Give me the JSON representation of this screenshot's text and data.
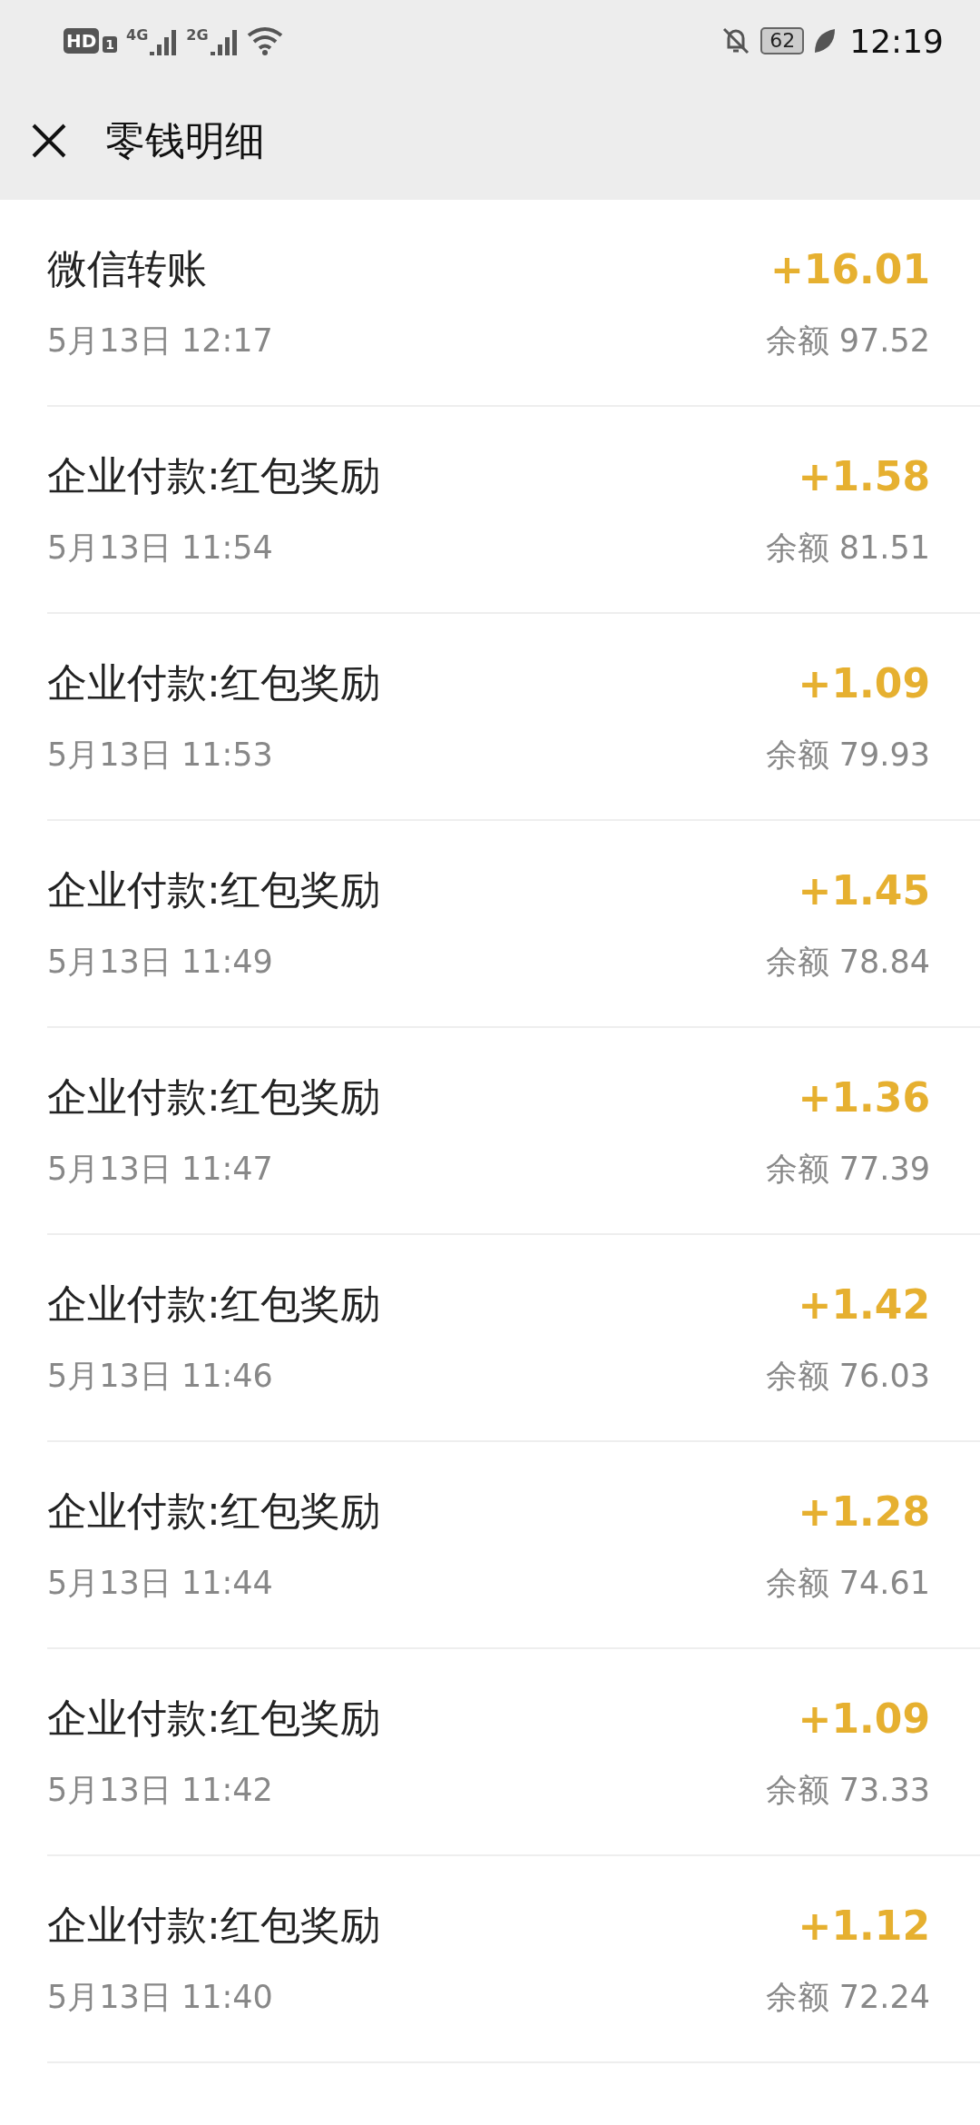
{
  "status_bar": {
    "hd_label": "HD",
    "sim_label": "1",
    "time": "12:19",
    "battery": "62",
    "signal_1_label": "4G",
    "signal_2_label": "2G"
  },
  "header": {
    "title": "零钱明细"
  },
  "transactions": [
    {
      "title": "微信转账",
      "time": "5月13日 12:17",
      "amount": "+16.01",
      "balance": "余额 97.52"
    },
    {
      "title": "企业付款:红包奖励",
      "time": "5月13日 11:54",
      "amount": "+1.58",
      "balance": "余额 81.51"
    },
    {
      "title": "企业付款:红包奖励",
      "time": "5月13日 11:53",
      "amount": "+1.09",
      "balance": "余额 79.93"
    },
    {
      "title": "企业付款:红包奖励",
      "time": "5月13日 11:49",
      "amount": "+1.45",
      "balance": "余额 78.84"
    },
    {
      "title": "企业付款:红包奖励",
      "time": "5月13日 11:47",
      "amount": "+1.36",
      "balance": "余额 77.39"
    },
    {
      "title": "企业付款:红包奖励",
      "time": "5月13日 11:46",
      "amount": "+1.42",
      "balance": "余额 76.03"
    },
    {
      "title": "企业付款:红包奖励",
      "time": "5月13日 11:44",
      "amount": "+1.28",
      "balance": "余额 74.61"
    },
    {
      "title": "企业付款:红包奖励",
      "time": "5月13日 11:42",
      "amount": "+1.09",
      "balance": "余额 73.33"
    },
    {
      "title": "企业付款:红包奖励",
      "time": "5月13日 11:40",
      "amount": "+1.12",
      "balance": "余额 72.24"
    }
  ]
}
